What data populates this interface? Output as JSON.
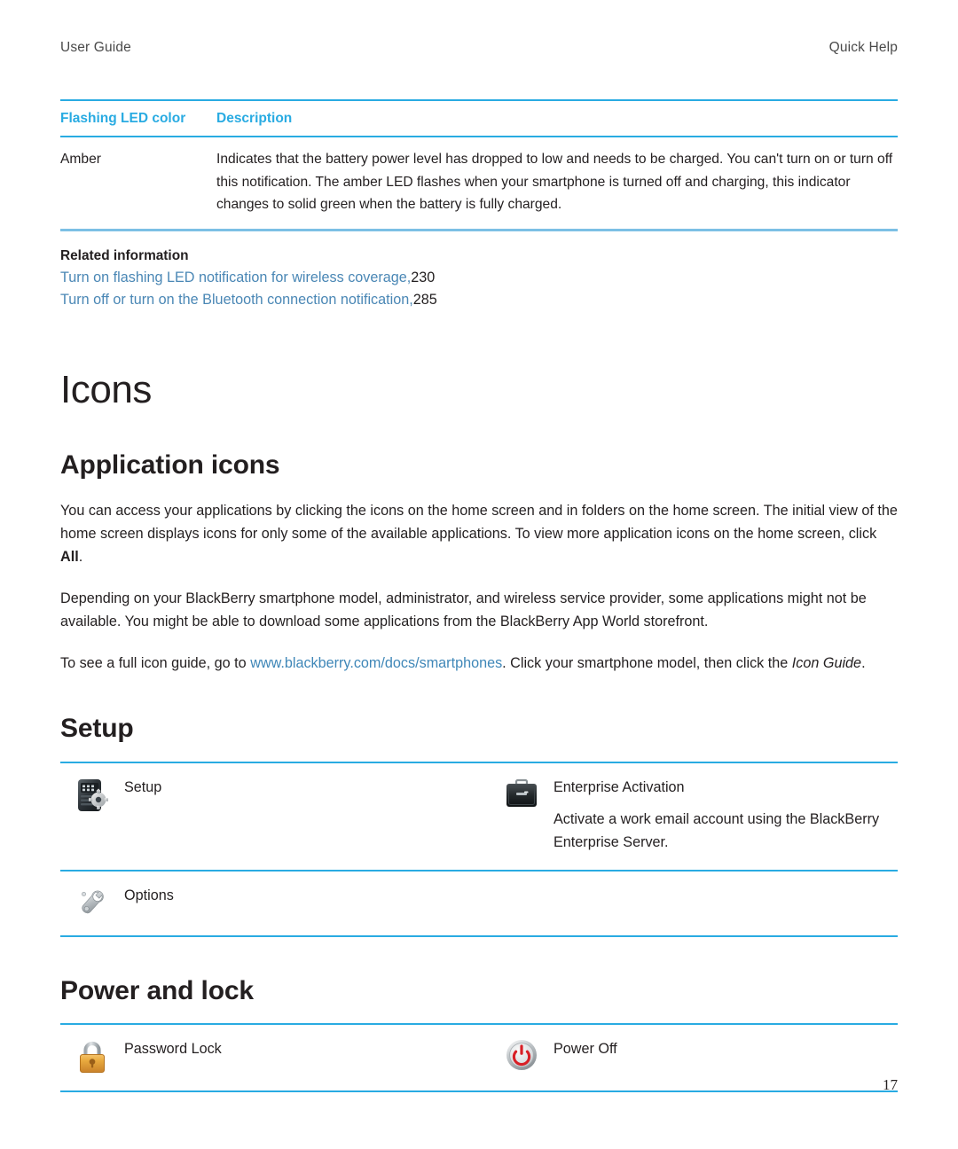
{
  "running_header": {
    "left": "User Guide",
    "right": "Quick Help"
  },
  "led_table": {
    "headers": {
      "color": "Flashing LED color",
      "description": "Description"
    },
    "rows": [
      {
        "color": "Amber",
        "description": "Indicates that the battery power level has dropped to low and needs to be charged. You can't turn on or turn off this notification. The amber LED flashes when your smartphone is turned off and charging, this indicator changes to solid green when the battery is fully charged."
      }
    ]
  },
  "related_information": {
    "title": "Related information",
    "links": [
      {
        "text": "Turn on flashing LED notification for wireless coverage,",
        "page": "230"
      },
      {
        "text": "Turn off or turn on the Bluetooth connection notification,",
        "page": "285"
      }
    ]
  },
  "chapter": {
    "title": "Icons"
  },
  "application_icons": {
    "heading": "Application icons",
    "paragraph1_part1": "You can access your applications by clicking the icons on the home screen and in folders on the home screen. The initial view of the home screen displays icons for only some of the available applications. To view more application icons on the home screen, click ",
    "paragraph1_bold": "All",
    "paragraph1_part2": ".",
    "paragraph2": "Depending on your BlackBerry smartphone model, administrator, and wireless service provider, some applications might not be available. You might be able to download some applications from the BlackBerry App World storefront.",
    "paragraph3_part1": "To see a full icon guide, go to ",
    "paragraph3_link": "www.blackberry.com/docs/smartphones",
    "paragraph3_part2": ". Click your smartphone model, then click the ",
    "paragraph3_italic": "Icon Guide",
    "paragraph3_part3": "."
  },
  "setup": {
    "heading": "Setup",
    "rows": [
      {
        "left": {
          "icon": "setup-device-gear-icon",
          "label": "Setup",
          "description": ""
        },
        "right": {
          "icon": "briefcase-icon",
          "label": "Enterprise Activation",
          "description": "Activate a work email account using the BlackBerry Enterprise Server."
        }
      },
      {
        "left": {
          "icon": "wrench-icon",
          "label": "Options",
          "description": ""
        },
        "right": {
          "icon": "",
          "label": "",
          "description": ""
        }
      }
    ]
  },
  "power_and_lock": {
    "heading": "Power and lock",
    "rows": [
      {
        "left": {
          "icon": "padlock-icon",
          "label": "Password Lock",
          "description": ""
        },
        "right": {
          "icon": "power-button-icon",
          "label": "Power Off",
          "description": ""
        }
      }
    ]
  },
  "folio": {
    "page_number": "17"
  },
  "colors": {
    "accent_cyan": "#29abe2",
    "rule_light_blue": "#7cc0e5",
    "link_blue": "#4a87b5",
    "text": "#231f20"
  }
}
